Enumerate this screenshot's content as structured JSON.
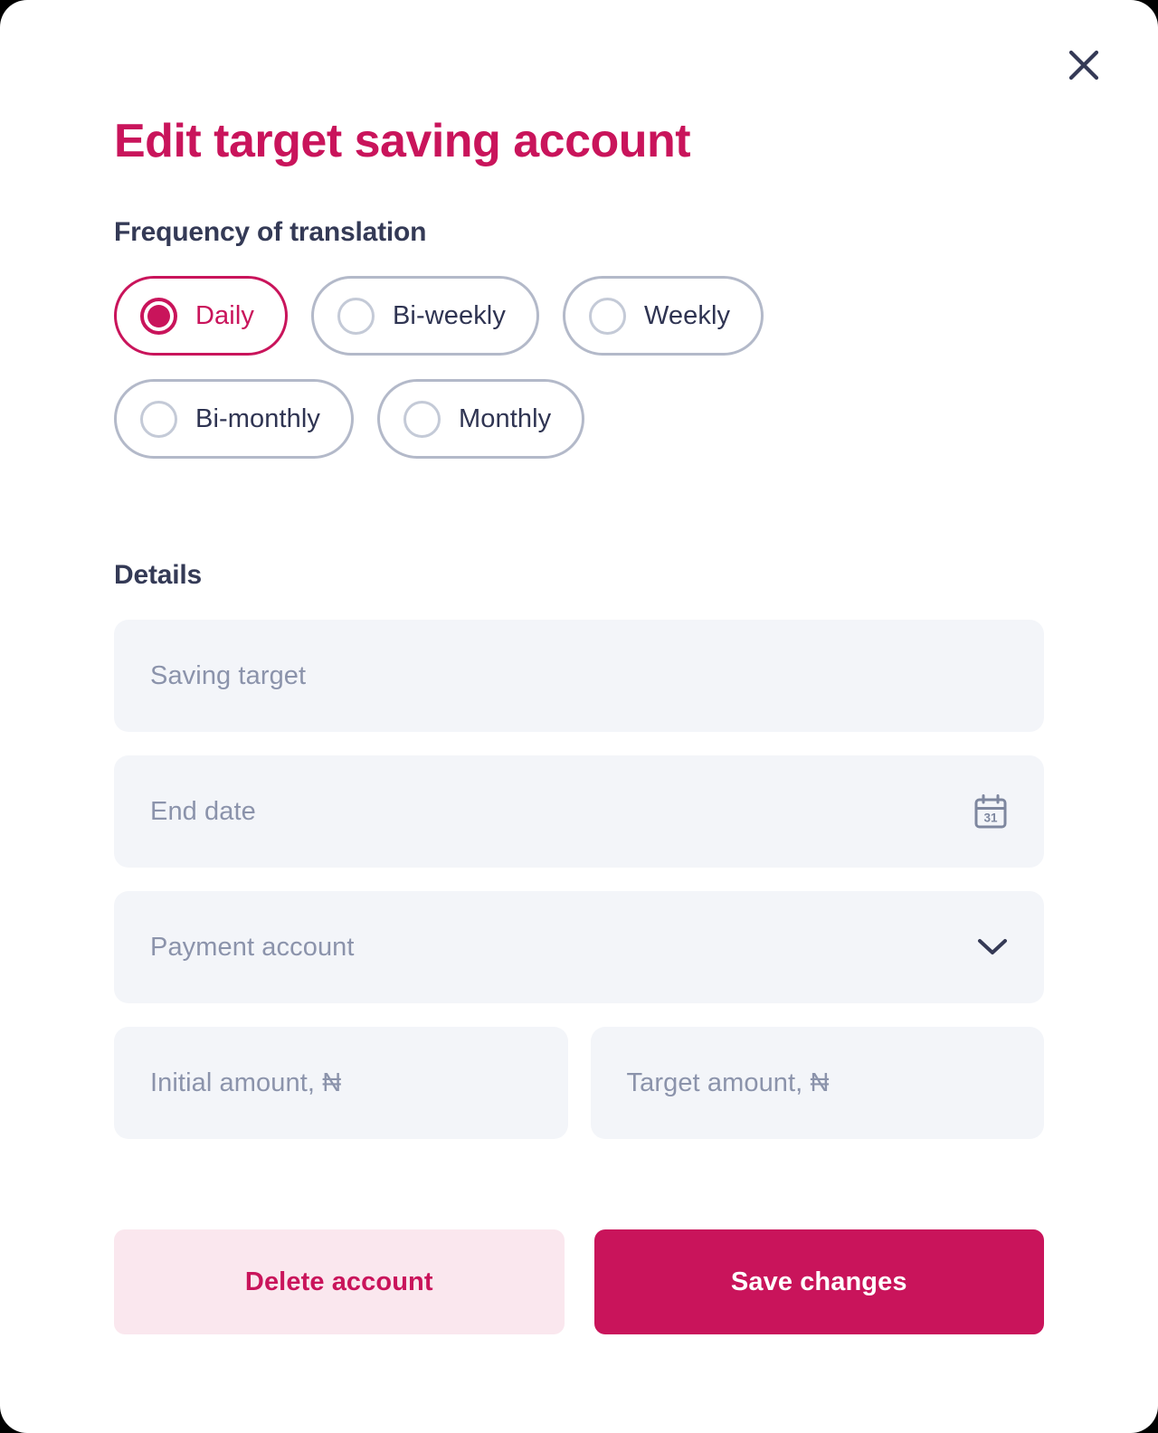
{
  "modal": {
    "title": "Edit target saving account",
    "close_icon": "close-icon"
  },
  "frequency": {
    "heading": "Frequency of translation",
    "options": [
      {
        "label": "Daily",
        "selected": true
      },
      {
        "label": "Bi-weekly",
        "selected": false
      },
      {
        "label": "Weekly",
        "selected": false
      },
      {
        "label": "Bi-monthly",
        "selected": false
      },
      {
        "label": "Monthly",
        "selected": false
      }
    ]
  },
  "details": {
    "heading": "Details",
    "fields": [
      {
        "name": "saving-target",
        "placeholder": "Saving target",
        "value": "",
        "icon": ""
      },
      {
        "name": "end-date",
        "placeholder": "End date",
        "value": "",
        "icon": "calendar-icon"
      },
      {
        "name": "payment-account",
        "placeholder": "Payment account",
        "value": "",
        "icon": "chevron-down-icon"
      },
      {
        "name": "initial-amount",
        "placeholder": "Initial amount, ₦",
        "value": "",
        "icon": ""
      },
      {
        "name": "target-amount",
        "placeholder": "Target amount, ₦",
        "value": "",
        "icon": ""
      }
    ],
    "calendar_icon_day": "31"
  },
  "actions": {
    "delete_label": "Delete account",
    "save_label": "Save changes"
  },
  "colors": {
    "accent": "#C9145B",
    "accent_soft": "#FAE7EE",
    "heading": "#343A56",
    "placeholder": "#8B93AB",
    "field_bg": "#F3F5F9",
    "pill_border": "#B3B9C9"
  }
}
